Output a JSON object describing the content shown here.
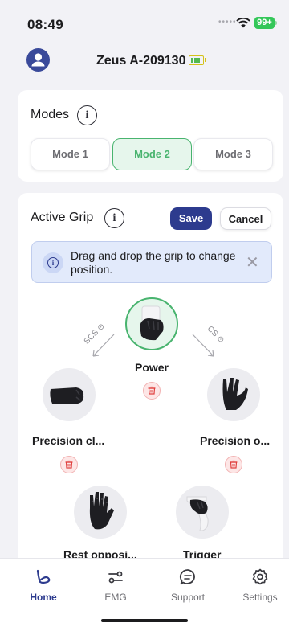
{
  "status": {
    "time": "08:49",
    "battery": "99+"
  },
  "header": {
    "device_name": "Zeus A-209130"
  },
  "modes": {
    "title": "Modes",
    "items": [
      "Mode 1",
      "Mode 2",
      "Mode 3"
    ],
    "active_index": 1
  },
  "grip": {
    "title": "Active Grip",
    "save_label": "Save",
    "cancel_label": "Cancel",
    "banner_text": "Drag and drop the grip to change position.",
    "arrow_left_label": "SCS",
    "arrow_right_label": "CS",
    "items": {
      "power": "Power",
      "precision_closed": "Precision cl...",
      "precision_open": "Precision o...",
      "rest_opposition": "Rest opposi...",
      "trigger": "Trigger"
    }
  },
  "tabs": {
    "home": "Home",
    "emg": "EMG",
    "support": "Support",
    "settings": "Settings",
    "active": "home"
  },
  "colors": {
    "accent": "#2d3b8e",
    "success": "#49b46f",
    "danger": "#e0403f",
    "background": "#f2f2f6"
  }
}
